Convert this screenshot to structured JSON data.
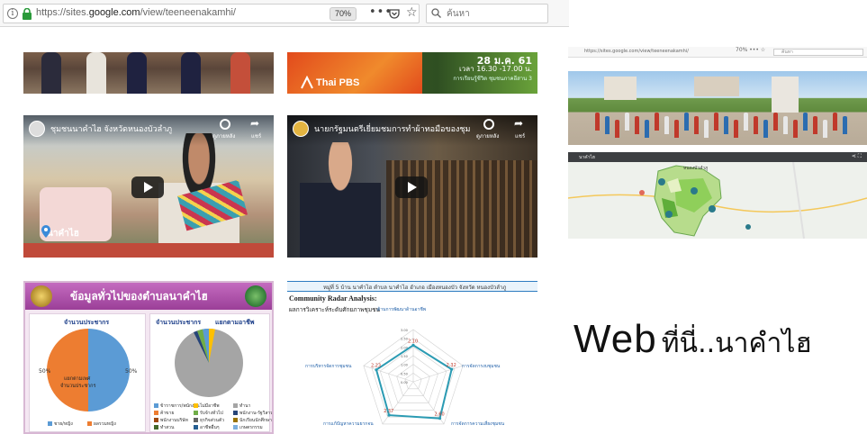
{
  "browser": {
    "url_prefix": "https://sites.",
    "url_domain": "google.com",
    "url_path": "/view/teeneenakamhi/",
    "zoom": "70%",
    "menu": "•••",
    "search_placeholder": "ค้นหา"
  },
  "thumbs": {
    "tv_brand": "Thai PBS",
    "tv_date": "28 ม.ค. 61",
    "tv_time": "เวลา 16.30 -17.00 น.",
    "tv_small": "การเรียนรู้ชีวิต ชุมชนภาคอีสาน 3"
  },
  "videos": [
    {
      "title": "ชุมชนนาคำไฮ จังหวัดหนองบัวลำภู",
      "watch_later": "ดูภายหลัง",
      "share": "แชร์",
      "poster_text": "นาคำไฮ"
    },
    {
      "title": "นายกรัฐมนตรีเยี่ยมชมการทำผ้าทอมือของชุม",
      "watch_later": "ดูภายหลัง",
      "share": "แชร์"
    }
  ],
  "slide1": {
    "title": "ข้อมูลทั่วไปของตำบลนาคำไฮ",
    "left_panel_title": "จำนวนประชากร",
    "right_panel_title": "แยกตามอาชีพ",
    "pie_left": {
      "center_label_1": "แยกตามเพศ",
      "center_label_2": "จำนวนประชากร",
      "pct_a": "50%",
      "pct_b": "50%",
      "legend_a": "ชาย/หญิง",
      "legend_b": "ผลรวมหญิง"
    },
    "legend_right": [
      "ข้าราชการ/พนักงาน",
      "ไม่มีอาชีพ",
      "ทำนา",
      "ค้าขาย",
      "รับจ้างทั่วไป",
      "พนักงาน-รัฐวิสาหกิจ",
      "พนักงานบริษัท",
      "ธุรกิจส่วนตัว",
      "นักเรียนนักศึกษา",
      "ทำสวน",
      "อาชีพอื่นๆ",
      "เกษตรกรรม"
    ],
    "colors": {
      "header": "#9b3f98",
      "pie_blue": "#5b9bd5",
      "pie_orange": "#ed7d31",
      "pie_gray": "#a5a5a5"
    }
  },
  "slide2": {
    "header": "หมู่ที่ 5 บ้าน นาคำไฮ ตำบล นาคำไฮ อำเภอ เมืองหนองบัว จังหวัด หนองบัวลำภู",
    "title": "Community Radar Analysis:",
    "subtitle": "ผลการวิเคราะห์ระดับศักยภาพชุมชน",
    "axes": [
      "ด้านการพัฒนาด้านอาชีพ",
      "การจัดการงบชุมชน",
      "การจัดการความเสี่ยงชุมชน",
      "การแก้ปัญหาความยากจน",
      "การบริหารจัดการชุมชน"
    ],
    "values": [
      2.1,
      2.32,
      2.6,
      2.37,
      2.23
    ],
    "value_labels": [
      "2.10",
      "2.32",
      "2.60",
      "2.37",
      "2.23"
    ],
    "scale_max": 3,
    "scale_ticks": [
      "0.00",
      "0.50",
      "1.00",
      "1.50",
      "2.00",
      "2.50",
      "3.00"
    ],
    "colors": {
      "series": "#2b9bb3",
      "labels": "#c0392b"
    }
  },
  "right": {
    "mini_url": "https://sites.google.com/view/teeneenakamhi/",
    "mini_zoom": "70%",
    "mini_search": "ค้นหา",
    "map_title": "นาคำไฮ",
    "map_label": "หนองบัวลำภู",
    "caption_en": "Web",
    "caption_th": "ที่นี่..นาคำไฮ"
  }
}
